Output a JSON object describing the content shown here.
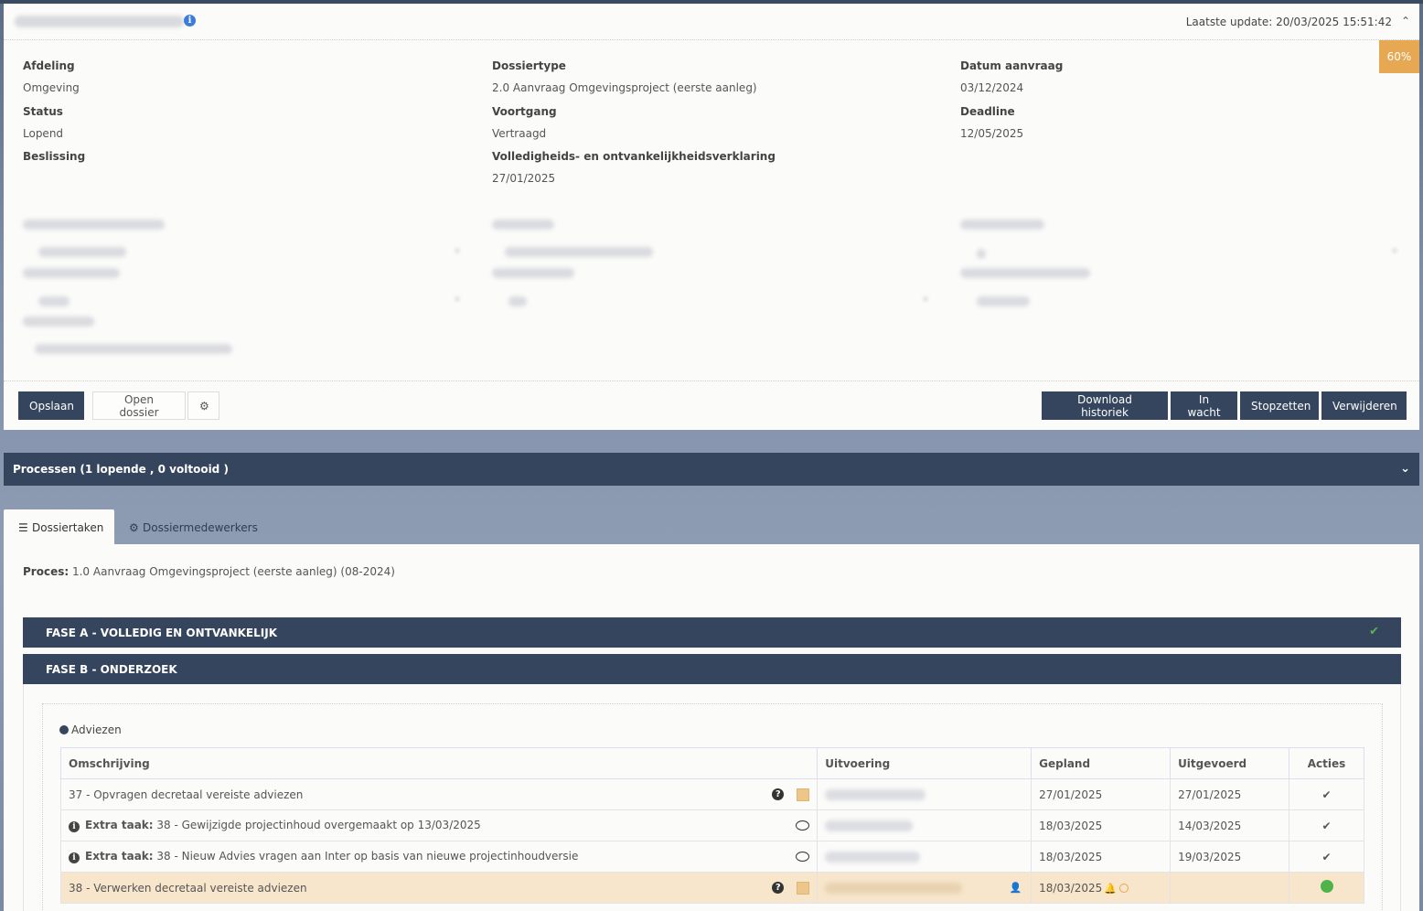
{
  "header": {
    "last_update": "Laatste update: 20/03/2025 15:51:42",
    "progress": "60%"
  },
  "fields": {
    "afdeling_label": "Afdeling",
    "afdeling_value": "Omgeving",
    "dossiertype_label": "Dossiertype",
    "dossiertype_value": "2.0 Aanvraag Omgevingsproject (eerste aanleg)",
    "datum_label": "Datum aanvraag",
    "datum_value": "03/12/2024",
    "status_label": "Status",
    "status_value": "Lopend",
    "voortgang_label": "Voortgang",
    "voortgang_value": "Vertraagd",
    "deadline_label": "Deadline",
    "deadline_value": "12/05/2025",
    "beslissing_label": "Beslissing",
    "verklaring_label": "Volledigheids- en ontvankelijkheidsverklaring",
    "verklaring_value": "27/01/2025"
  },
  "actions": {
    "opslaan": "Opslaan",
    "open_dossier": "Open dossier",
    "download": "Download historiek",
    "in_wacht": "In wacht",
    "stopzetten": "Stopzetten",
    "verwijderen": "Verwijderen"
  },
  "processen": {
    "title": "Processen (1 lopende , 0 voltooid )"
  },
  "tabs": {
    "dossiertaken": "Dossiertaken",
    "dossiermedewerkers": "Dossiermedewerkers"
  },
  "proces": {
    "label": "Proces:",
    "value": "1.0 Aanvraag Omgevingsproject (eerste aanleg) (08-2024)"
  },
  "fases": {
    "a": "FASE A - VOLLEDIG EN ONTVANKELIJK",
    "b": "FASE B - ONDERZOEK"
  },
  "group": {
    "title": "Adviezen"
  },
  "table": {
    "headers": {
      "omschrijving": "Omschrijving",
      "uitvoering": "Uitvoering",
      "gepland": "Gepland",
      "uitgevoerd": "Uitgevoerd",
      "acties": "Acties"
    },
    "rows": [
      {
        "omschrijving": "37 - Opvragen decretaal vereiste adviezen",
        "gepland": "27/01/2025",
        "uitgevoerd": "27/01/2025"
      },
      {
        "prefix": "Extra taak:",
        "omschrijving": " 38 - Gewijzigde projectinhoud overgemaakt op 13/03/2025",
        "gepland": "18/03/2025",
        "uitgevoerd": "14/03/2025"
      },
      {
        "prefix": "Extra taak:",
        "omschrijving": " 38 - Nieuw Advies vragen aan Inter op basis van nieuwe projectinhoudversie",
        "gepland": "18/03/2025",
        "uitgevoerd": "19/03/2025"
      },
      {
        "omschrijving": "38 - Verwerken decretaal vereiste adviezen",
        "gepland": "18/03/2025",
        "uitgevoerd": ""
      }
    ]
  },
  "icons": {
    "info": "info-icon",
    "chevron_up": "chevron-up-icon",
    "chevron_down": "chevron-down-icon",
    "gear": "gear-icon",
    "list": "list-icon",
    "check": "check-icon",
    "question": "question-icon",
    "note": "note-icon",
    "chat": "chat-icon",
    "user": "user-icon",
    "bell": "bell-icon",
    "clock": "clock-icon",
    "status_dot": "status-dot-icon"
  },
  "colors": {
    "dark": "#34455d",
    "accent": "#e6a853",
    "success": "#4fb34a"
  }
}
